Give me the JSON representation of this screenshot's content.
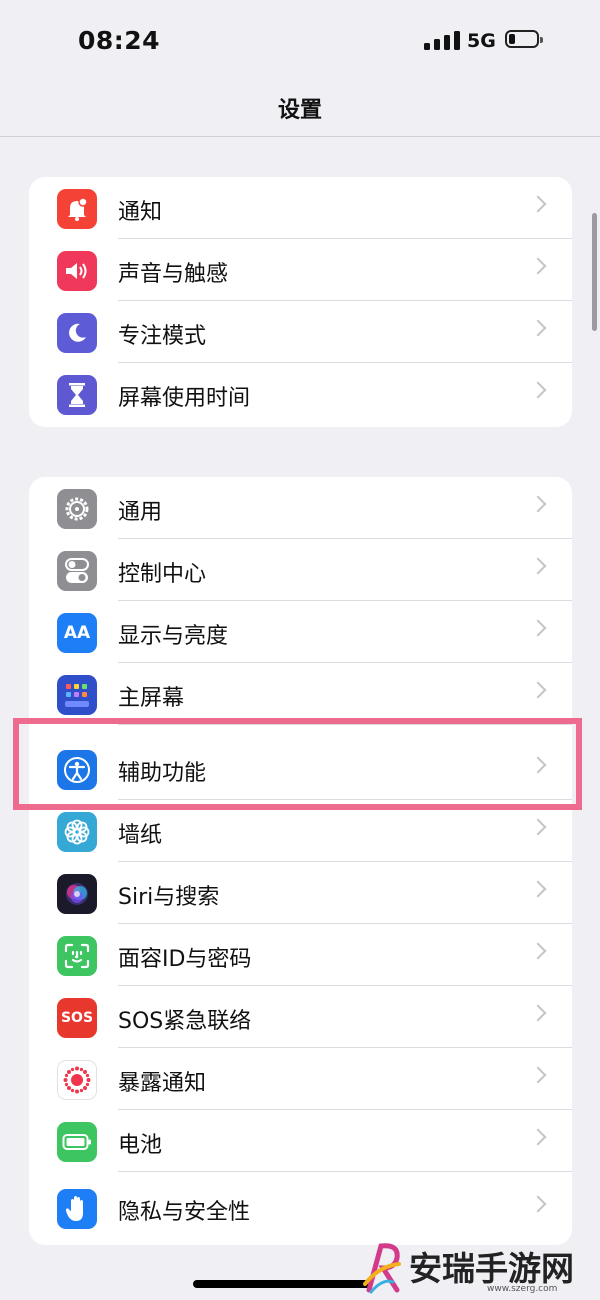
{
  "status_bar": {
    "time": "08:24",
    "network": "5G"
  },
  "nav": {
    "title": "设置"
  },
  "group1": [
    {
      "label": "通知",
      "icon": "bell-icon",
      "color": "#f44336"
    },
    {
      "label": "声音与触感",
      "icon": "speaker-icon",
      "color": "#f0395a"
    },
    {
      "label": "专注模式",
      "icon": "moon-icon",
      "color": "#5d5cd6"
    },
    {
      "label": "屏幕使用时间",
      "icon": "hourglass-icon",
      "color": "#5e59d2"
    }
  ],
  "group2": [
    {
      "label": "通用",
      "icon": "gear-icon",
      "color": "#8e8e93"
    },
    {
      "label": "控制中心",
      "icon": "toggles-icon",
      "color": "#8e8e93"
    },
    {
      "label": "显示与亮度",
      "icon": "text-size-icon",
      "color": "#1e7ef5",
      "glyph": "AA"
    },
    {
      "label": "主屏幕",
      "icon": "home-screen-grid-icon",
      "color": "#2f4ec9"
    },
    {
      "label": "辅助功能",
      "icon": "accessibility-icon",
      "color": "#1c76e8"
    },
    {
      "label": "墙纸",
      "icon": "flower-icon",
      "color": "#35a8d6"
    },
    {
      "label": "Siri与搜索",
      "icon": "siri-icon",
      "color": "#1a1a2a"
    },
    {
      "label": "面容ID与密码",
      "icon": "face-id-icon",
      "color": "#3dc561"
    },
    {
      "label": "SOS紧急联络",
      "icon": "sos-icon",
      "color": "#e8382e",
      "glyph": "SOS"
    },
    {
      "label": "暴露通知",
      "icon": "exposure-icon",
      "color": "#ffffff"
    },
    {
      "label": "电池",
      "icon": "battery-icon",
      "color": "#3dc561"
    },
    {
      "label": "隐私与安全性",
      "icon": "hand-icon",
      "color": "#1e7ef5"
    }
  ],
  "highlight_label": "辅助功能",
  "watermark": {
    "text": "安瑞手游网",
    "url": "www.szerg.com"
  }
}
